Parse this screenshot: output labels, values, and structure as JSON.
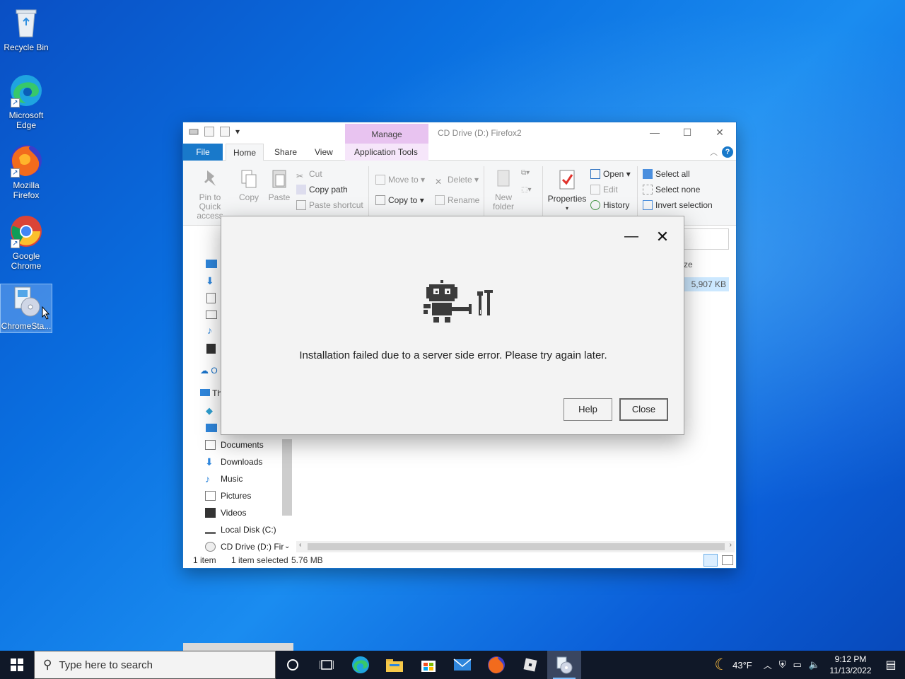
{
  "desktop": {
    "icons": [
      {
        "label": "Recycle Bin",
        "icon": "recycle-bin-icon"
      },
      {
        "label": "Microsoft Edge",
        "icon": "edge-icon"
      },
      {
        "label": "Mozilla Firefox",
        "icon": "firefox-icon"
      },
      {
        "label": "Google Chrome",
        "icon": "chrome-icon"
      },
      {
        "label": "ChromeSta...",
        "icon": "installer-icon"
      }
    ]
  },
  "explorer": {
    "context_tab": "Manage",
    "title": "CD Drive (D:) Firefox2",
    "tabs": {
      "file": "File",
      "home": "Home",
      "share": "Share",
      "view": "View",
      "app_tools": "Application Tools"
    },
    "ribbon": {
      "pin": "Pin to Quick access",
      "copy": "Copy",
      "paste": "Paste",
      "cut": "Cut",
      "copy_path": "Copy path",
      "paste_shortcut": "Paste shortcut",
      "move_to": "Move to",
      "copy_to": "Copy to",
      "delete": "Delete",
      "rename": "Rename",
      "new_folder": "New folder",
      "properties": "Properties",
      "open": "Open",
      "edit": "Edit",
      "history": "History",
      "select_all": "Select all",
      "select_none": "Select none",
      "invert_selection": "Invert selection"
    },
    "nav": {
      "onedrive_partial": "O",
      "thispc_partial": "Th",
      "items": [
        "Documents",
        "Downloads",
        "Music",
        "Pictures",
        "Videos",
        "Local Disk (C:)",
        "CD Drive (D:) Fir"
      ]
    },
    "content": {
      "size_header_partial": "ze",
      "file_size": "5,907 KB"
    },
    "status": {
      "items": "1 item",
      "selected": "1 item selected",
      "size": "5.76 MB"
    }
  },
  "dialog": {
    "message": "Installation failed due to a server side error. Please try again later.",
    "help_label": "Help",
    "close_label": "Close"
  },
  "taskbar": {
    "search_placeholder": "Type here to search",
    "weather": "43°F",
    "time": "9:12 PM",
    "date": "11/13/2022"
  },
  "colors": {
    "accent": "#1979ca",
    "taskbar": "#101828",
    "manage_tab": "#e8c3f0"
  }
}
